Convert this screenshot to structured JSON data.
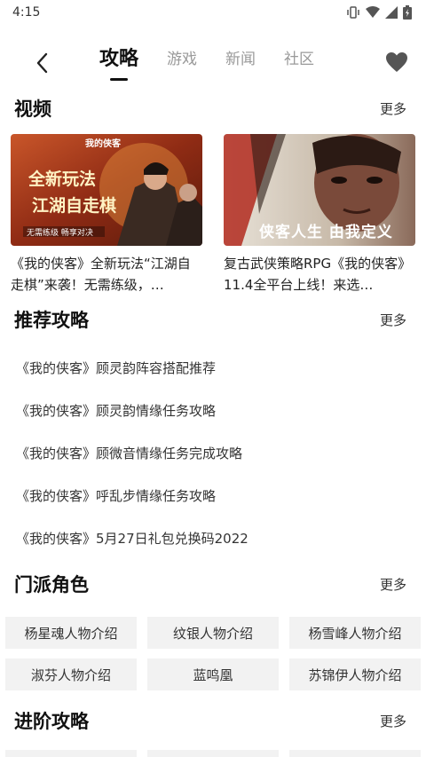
{
  "status": {
    "time": "4:15"
  },
  "nav": {
    "tabs": [
      {
        "label": "攻略",
        "active": true
      },
      {
        "label": "游戏",
        "active": false
      },
      {
        "label": "新闻",
        "active": false
      },
      {
        "label": "社区",
        "active": false
      }
    ]
  },
  "videos": {
    "title": "视频",
    "more": "更多",
    "items": [
      {
        "title": "《我的侠客》全新玩法“江湖自走棋”来袭！无需练级，…",
        "thumb_text": "全新玩法",
        "thumb_text2": "江湖自走棋",
        "thumb_logo": "我的侠客",
        "thumb_caption": "无需练级 畅享对决"
      },
      {
        "title": "复古武侠策略RPG《我的侠客》11.4全平台上线！来选…",
        "thumb_text": "侠客人生 由我定义"
      }
    ]
  },
  "guides": {
    "title": "推荐攻略",
    "more": "更多",
    "items": [
      "《我的侠客》顾灵韵阵容搭配推荐",
      "《我的侠客》顾灵韵情缘任务攻略",
      "《我的侠客》顾微音情缘任务完成攻略",
      "《我的侠客》呼乱步情缘任务攻略",
      "《我的侠客》5月27日礼包兑换码2022"
    ]
  },
  "sects": {
    "title": "门派角色",
    "more": "更多",
    "items": [
      "杨星魂人物介绍",
      "纹银人物介绍",
      "杨雪峰人物介绍",
      "淑芬人物介绍",
      "蓝鸣凰",
      "苏锦伊人物介绍"
    ]
  },
  "advanced": {
    "title": "进阶攻略",
    "more": "更多"
  },
  "colors": {
    "accent": "#111111",
    "inactive_tab": "#999999",
    "chip_bg": "#f2f2f2"
  },
  "icons": [
    "back-arrow-icon",
    "heart-icon",
    "vibrate-icon",
    "wifi-icon",
    "signal-icon",
    "battery-icon"
  ]
}
